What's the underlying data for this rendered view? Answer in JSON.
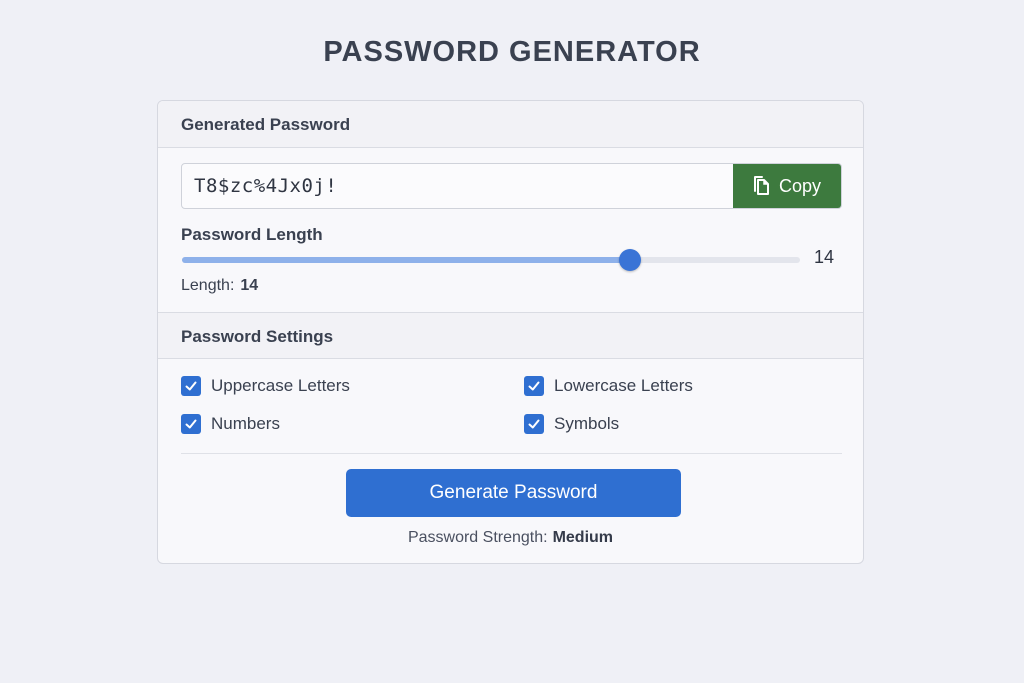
{
  "page": {
    "title": "PASSWORD GENERATOR"
  },
  "generated": {
    "header": "Generated Password",
    "password": "T8$zc%4Jx0j!",
    "copy_label": "Copy",
    "copy_icon": "copy-icon",
    "copy_color": "#3d7a3e"
  },
  "length": {
    "label": "Password Length",
    "value": "14",
    "readout_label": "Length:",
    "readout_value": "14",
    "slider_fraction": 0.725,
    "accent": "#3a74d6"
  },
  "settings": {
    "header": "Password Settings",
    "options": [
      {
        "label": "Uppercase Letters",
        "checked": true
      },
      {
        "label": "Lowercase Letters",
        "checked": true
      },
      {
        "label": "Numbers",
        "checked": true
      },
      {
        "label": "Symbols",
        "checked": true
      }
    ]
  },
  "generate": {
    "label": "Generate Password",
    "color": "#2f6fd1"
  },
  "strength": {
    "label": "Password Strength:",
    "value": "Medium"
  }
}
